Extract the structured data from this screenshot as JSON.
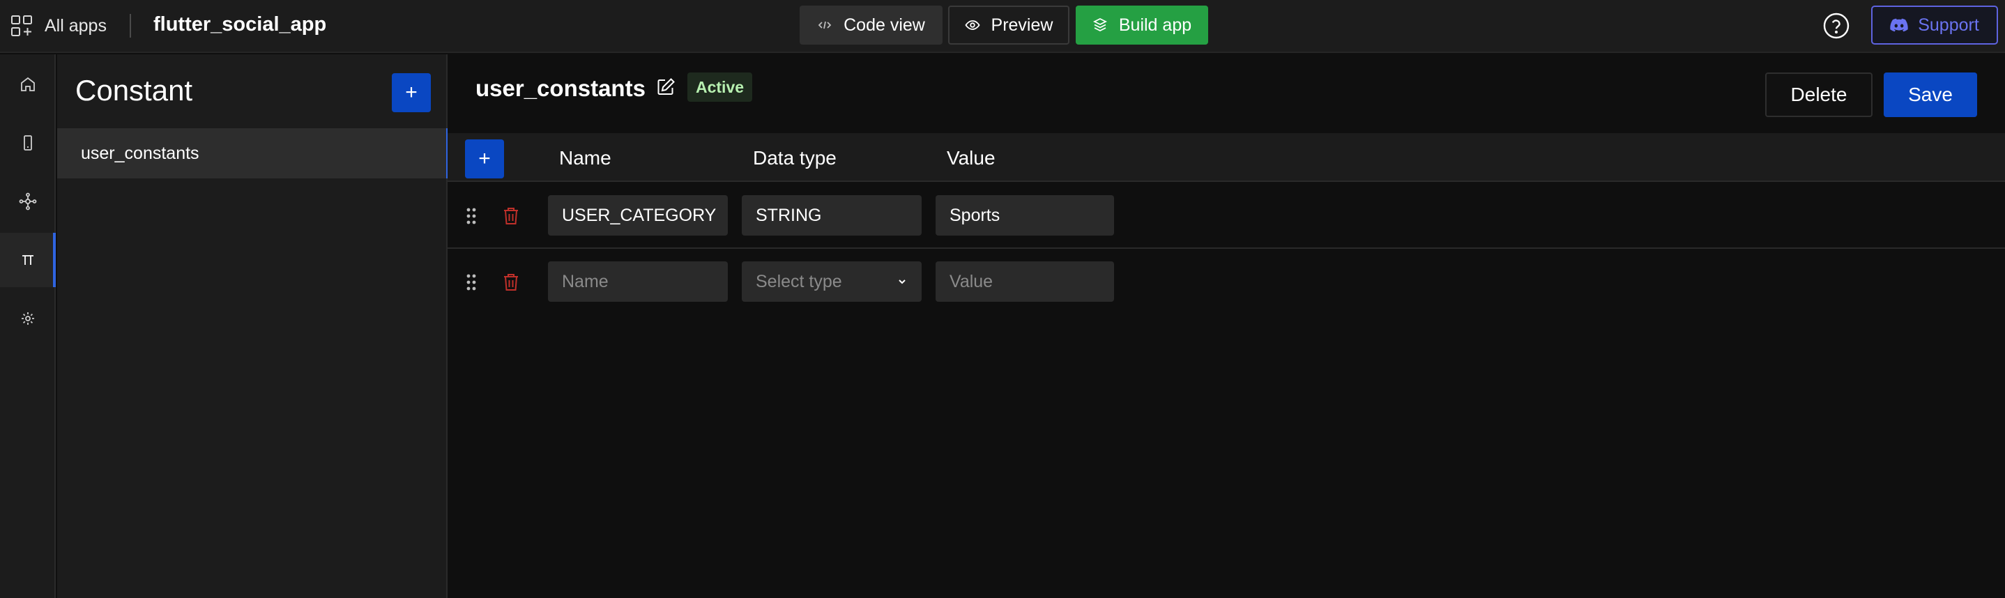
{
  "topbar": {
    "all_apps_label": "All apps",
    "app_name": "flutter_social_app",
    "code_view_label": "Code view",
    "preview_label": "Preview",
    "build_app_label": "Build app",
    "support_label": "Support"
  },
  "rail": {
    "items": [
      "home-icon",
      "mobile-icon",
      "network-icon",
      "pi-icon",
      "settings-icon"
    ],
    "active": "pi-icon"
  },
  "panel": {
    "title": "Constant",
    "add_label": "+",
    "items": [
      {
        "label": "user_constants",
        "selected": true
      }
    ]
  },
  "main": {
    "title": "user_constants",
    "status_badge": "Active",
    "delete_label": "Delete",
    "save_label": "Save",
    "table": {
      "add_label": "+",
      "headers": {
        "name": "Name",
        "data_type": "Data type",
        "value": "Value"
      },
      "rows": [
        {
          "name": "USER_CATEGORY",
          "data_type": "STRING",
          "value": "Sports"
        }
      ],
      "new_row": {
        "name_placeholder": "Name",
        "type_placeholder": "Select type",
        "value_placeholder": "Value"
      }
    }
  },
  "colors": {
    "accent_blue": "#0a47c2",
    "build_green": "#25a043",
    "support_purple": "#5e63e0",
    "trash_red": "#c0302a",
    "badge_green_text": "#b7f0b0"
  }
}
